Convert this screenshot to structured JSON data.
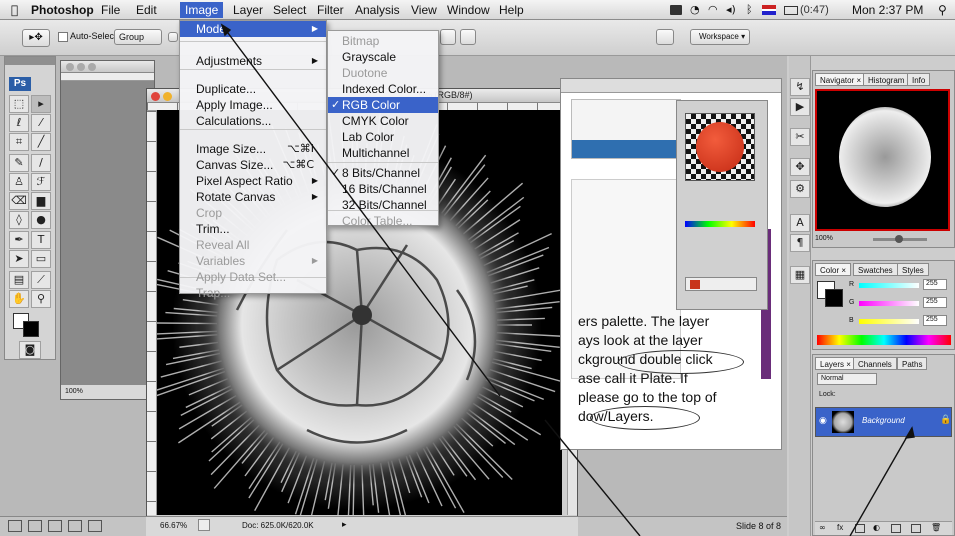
{
  "menubar": {
    "apple": "",
    "app_name": "Photoshop",
    "items": [
      "File",
      "Edit",
      "Image",
      "Layer",
      "Select",
      "Filter",
      "Analysis",
      "View",
      "Window",
      "Help"
    ],
    "status": {
      "battery": "(0:47)",
      "clock": "Mon 2:37 PM"
    }
  },
  "options_bar": {
    "auto_select": "Auto-Select:",
    "group_value": "Group",
    "workspace": "Workspace ▾"
  },
  "tools_panel": {
    "ps_badge": "Ps"
  },
  "image_menu": {
    "items": [
      {
        "label": "Mode",
        "shortcut": "",
        "submenu": true,
        "disabled": false,
        "highlight": true
      },
      {
        "label": "Adjustments",
        "shortcut": "",
        "submenu": true,
        "disabled": false,
        "highlight": false
      },
      {
        "label": "Duplicate...",
        "shortcut": "",
        "submenu": false,
        "disabled": false,
        "highlight": false
      },
      {
        "label": "Apply Image...",
        "shortcut": "",
        "submenu": false,
        "disabled": false,
        "highlight": false
      },
      {
        "label": "Calculations...",
        "shortcut": "",
        "submenu": false,
        "disabled": false,
        "highlight": false
      },
      {
        "label": "Image Size...",
        "shortcut": "⌥⌘I",
        "submenu": false,
        "disabled": false,
        "highlight": false
      },
      {
        "label": "Canvas Size...",
        "shortcut": "⌥⌘C",
        "submenu": false,
        "disabled": false,
        "highlight": false
      },
      {
        "label": "Pixel Aspect Ratio",
        "shortcut": "",
        "submenu": true,
        "disabled": false,
        "highlight": false
      },
      {
        "label": "Rotate Canvas",
        "shortcut": "",
        "submenu": true,
        "disabled": false,
        "highlight": false
      },
      {
        "label": "Crop",
        "shortcut": "",
        "submenu": false,
        "disabled": true,
        "highlight": false
      },
      {
        "label": "Trim...",
        "shortcut": "",
        "submenu": false,
        "disabled": false,
        "highlight": false
      },
      {
        "label": "Reveal All",
        "shortcut": "",
        "submenu": false,
        "disabled": true,
        "highlight": false
      },
      {
        "label": "Variables",
        "shortcut": "",
        "submenu": true,
        "disabled": true,
        "highlight": false
      },
      {
        "label": "Apply Data Set...",
        "shortcut": "",
        "submenu": false,
        "disabled": true,
        "highlight": false
      },
      {
        "label": "Trap...",
        "shortcut": "",
        "submenu": false,
        "disabled": true,
        "highlight": false
      }
    ]
  },
  "mode_submenu": {
    "items": [
      {
        "label": "Bitmap",
        "checked": false,
        "disabled": true,
        "highlight": false
      },
      {
        "label": "Grayscale",
        "checked": false,
        "disabled": false,
        "highlight": false
      },
      {
        "label": "Duotone",
        "checked": false,
        "disabled": true,
        "highlight": false
      },
      {
        "label": "Indexed Color...",
        "checked": false,
        "disabled": false,
        "highlight": false
      },
      {
        "label": "RGB Color",
        "checked": true,
        "disabled": false,
        "highlight": true
      },
      {
        "label": "CMYK Color",
        "checked": false,
        "disabled": false,
        "highlight": false
      },
      {
        "label": "Lab Color",
        "checked": false,
        "disabled": false,
        "highlight": false
      },
      {
        "label": "Multichannel",
        "checked": false,
        "disabled": false,
        "highlight": false
      },
      {
        "label": "8 Bits/Channel",
        "checked": true,
        "disabled": false,
        "highlight": false
      },
      {
        "label": "16 Bits/Channel",
        "checked": false,
        "disabled": false,
        "highlight": false
      },
      {
        "label": "32 Bits/Channel",
        "checked": false,
        "disabled": false,
        "highlight": false
      },
      {
        "label": "Color Table...",
        "checked": false,
        "disabled": true,
        "highlight": false
      }
    ]
  },
  "document": {
    "title_fragment": "0% (RGB/8#)",
    "zoom": "66.67%",
    "doc_size": "Doc: 625.0K/620.0K"
  },
  "gray_window": {
    "zoom": "100%"
  },
  "word_doc": {
    "lines": [
      "ers palette.  The layer",
      "ays look at the layer",
      "ckground double click",
      "ase call it Plate.  If",
      "please go to the top of",
      "dow/Layers."
    ]
  },
  "right_panels": {
    "navigator_tabs": [
      "Navigator ×",
      "Histogram",
      "Info"
    ],
    "nav_zoom": "100%",
    "color_tabs": [
      "Color ×",
      "Swatches",
      "Styles"
    ],
    "color_values": [
      {
        "channel": "R",
        "value": "255"
      },
      {
        "channel": "G",
        "value": "255"
      },
      {
        "channel": "B",
        "value": "255"
      }
    ],
    "layers_tabs": [
      "Layers ×",
      "Channels",
      "Paths"
    ],
    "blend_mode": "Normal",
    "lock_label": "Lock:",
    "layer_name": "Background"
  },
  "bottom": {
    "slide_indicator": "Slide 8 of 8"
  },
  "colors": {
    "menu_highlight": "#3a63c9",
    "canvas": "#000000",
    "tomato": "#d8341c"
  }
}
